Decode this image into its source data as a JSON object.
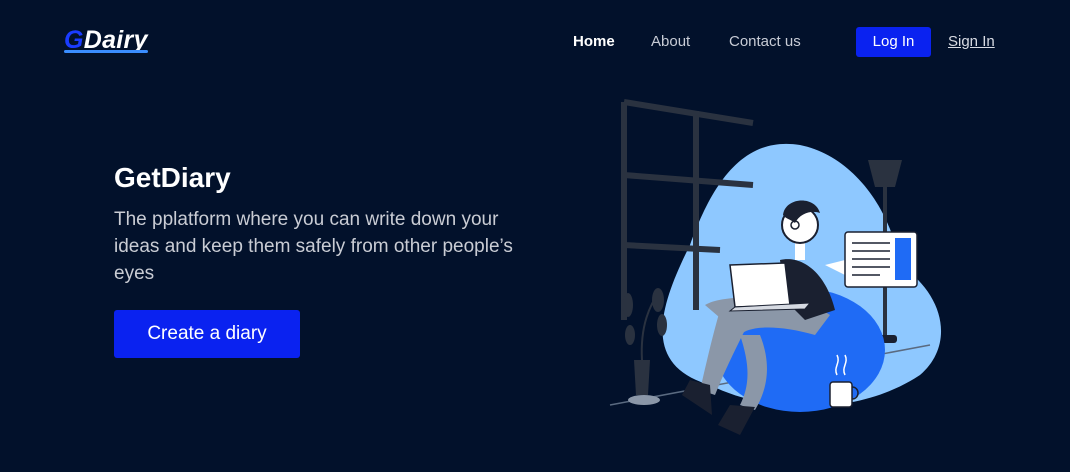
{
  "brand": {
    "initial": "G",
    "rest": "Dairy"
  },
  "nav": {
    "items": [
      {
        "label": "Home"
      },
      {
        "label": "About"
      },
      {
        "label": "Contact us"
      }
    ],
    "login_label": "Log In",
    "signin_label": "Sign In"
  },
  "hero": {
    "title": "GetDiary",
    "description": "The pplatform where you can write down your ideas and keep them safely from other people’s eyes",
    "cta_label": "Create a diary"
  },
  "colors": {
    "background": "#02112b",
    "accent": "#0a22f0",
    "illustration_blob": "#8ec8ff",
    "illustration_chair": "#1f6bf5"
  },
  "illustration": {
    "icon": "man-with-laptop-illustration"
  }
}
